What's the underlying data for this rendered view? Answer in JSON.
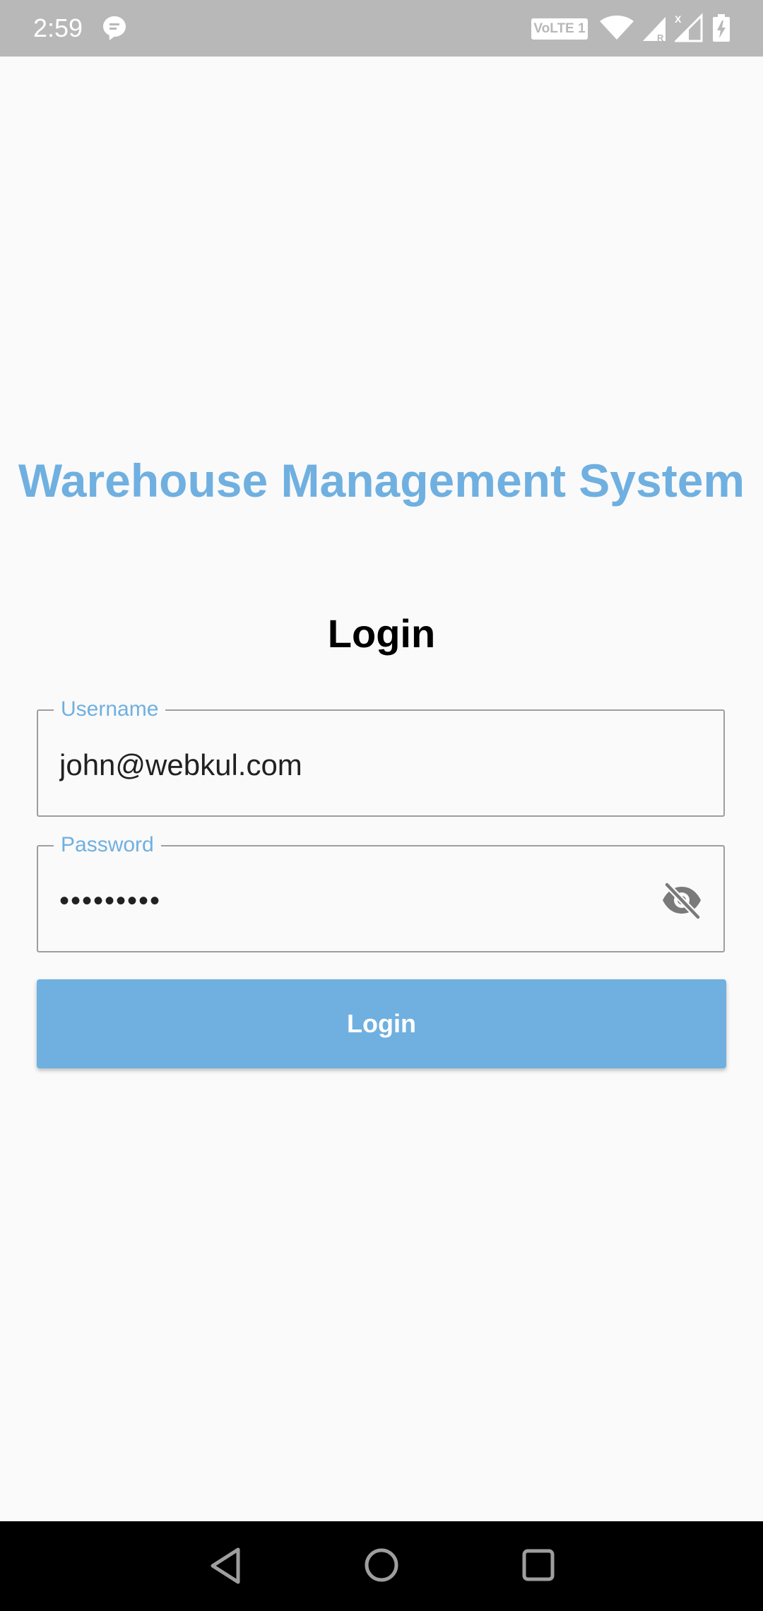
{
  "status_bar": {
    "time": "2:59",
    "volte_label": "VoLTE 1",
    "icons": [
      "message-icon",
      "wifi-icon",
      "signal-icon",
      "signal-roaming-icon",
      "battery-icon"
    ]
  },
  "app": {
    "title": "Warehouse Management System",
    "heading": "Login"
  },
  "form": {
    "username": {
      "label": "Username",
      "value": "john@webkul.com"
    },
    "password": {
      "label": "Password",
      "value": "•••••••••",
      "visibility_icon": "eye-off-icon"
    },
    "submit_label": "Login"
  },
  "nav_bar": {
    "icons": [
      "back-icon",
      "home-icon",
      "recent-apps-icon"
    ]
  },
  "colors": {
    "accent": "#6fb0e0",
    "background": "#fafafa",
    "status_bar": "#b8b8b8",
    "nav_bar": "#000000",
    "border": "#9e9e9e"
  }
}
